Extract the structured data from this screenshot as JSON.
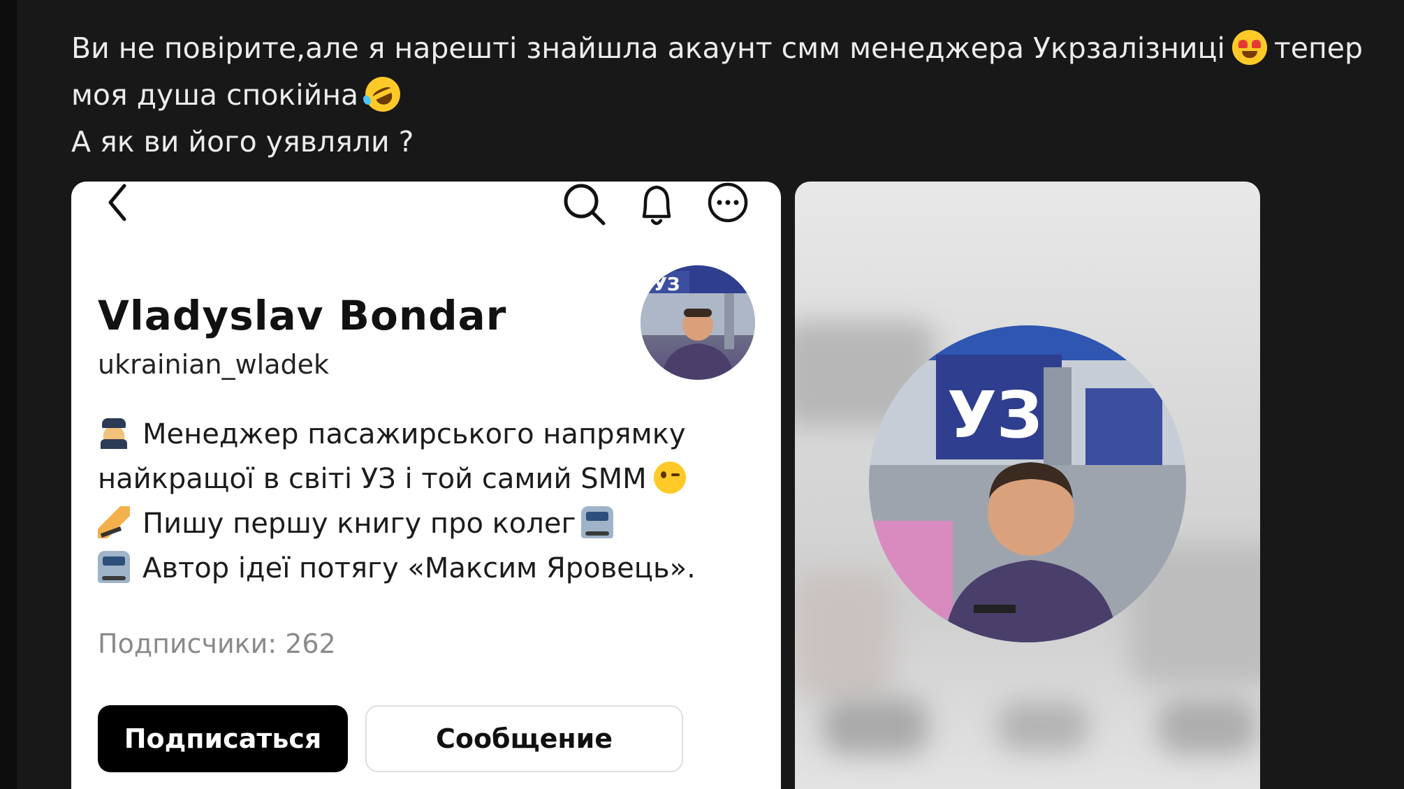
{
  "post": {
    "line1": "Ви не повірите,але я нарешті знайшла акаунт смм менеджера Укрзалізниці",
    "line1_end": "тепер",
    "line2": "моя душа спокійна",
    "line3": "А як ви його уявляли ?",
    "emoji1": "heart-eyes-emoji",
    "emoji2": "rofl-emoji"
  },
  "profile": {
    "name": "Vladyslav  Bondar",
    "handle": "ukrainian_wladek",
    "bio": [
      "Менеджер пасажирського напрямку",
      "найкращої в світі УЗ і той самий SMM",
      "Пишу першу книгу про колег",
      "Автор ідеї потягу «Максим Яровець»."
    ],
    "followers": "Подписчики: 262",
    "follow_label": "Подписаться",
    "message_label": "Сообщение",
    "avatar_sign_text": "УЗ"
  },
  "colors": {
    "background": "#181818",
    "text": "#ececec",
    "card": "#ffffff",
    "primary_button": "#000000",
    "muted": "#8a8a8a",
    "uz_blue": "#2f3e8e"
  }
}
